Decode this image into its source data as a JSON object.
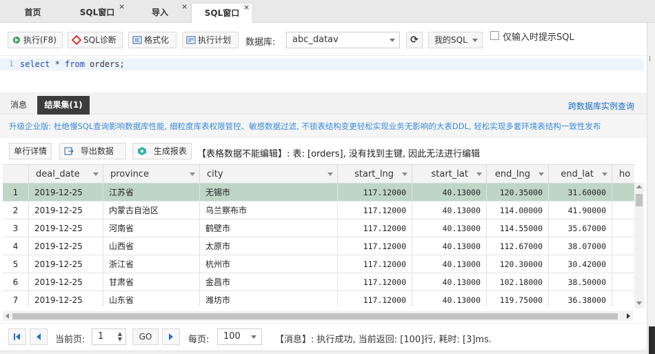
{
  "tabs": [
    {
      "label": "首页",
      "close": ""
    },
    {
      "label": "SQL窗口",
      "close": "×"
    },
    {
      "label": "导入",
      "close": "×"
    },
    {
      "label": "SQL窗口",
      "close": "×"
    }
  ],
  "toolbar": {
    "execute": "执行(F8)",
    "diagnose": "SQL诊断",
    "format": "格式化",
    "plan": "执行计划",
    "db_label": "数据库:",
    "db_value": "abc_datav",
    "my_sql": "我的SQL",
    "hint_only": "仅输入时提示SQL"
  },
  "editor": {
    "line_no": "1",
    "kw_select": "select",
    "star": " * ",
    "kw_from": "from",
    "rest": " orders;"
  },
  "result_tabs": {
    "messages": "消息",
    "result_set": "结果集(1)",
    "cross_db": "跨数据库实例查询"
  },
  "promo": "升级企业版: 杜绝慢SQL查询影响数据库性能, 细粒度库表权限管控、敏感数据过滤, 不锁表结构变更轻松实现业务无影响的大表DDL, 轻松实现多套环境表结构一致性发布",
  "actions": {
    "row_detail": "单行详情",
    "export": "导出数据",
    "report": "生成报表",
    "notice": "【表格数据不能编辑】: 表: [orders], 没有找到主键, 因此无法进行编辑"
  },
  "grid": {
    "columns": [
      "deal_date",
      "province",
      "city",
      "start_lng",
      "start_lat",
      "end_lng",
      "end_lat",
      "ho"
    ],
    "rows": [
      {
        "idx": "1",
        "deal_date": "2019-12-25",
        "province": "江苏省",
        "city": "无锡市",
        "start_lng": "117.12000",
        "start_lat": "40.13000",
        "end_lng": "120.35000",
        "end_lat": "31.60000"
      },
      {
        "idx": "2",
        "deal_date": "2019-12-25",
        "province": "内蒙古自治区",
        "city": "乌兰察布市",
        "start_lng": "117.12000",
        "start_lat": "40.13000",
        "end_lng": "114.00000",
        "end_lat": "41.90000"
      },
      {
        "idx": "3",
        "deal_date": "2019-12-25",
        "province": "河南省",
        "city": "鹤壁市",
        "start_lng": "117.12000",
        "start_lat": "40.13000",
        "end_lng": "114.55000",
        "end_lat": "35.67000"
      },
      {
        "idx": "4",
        "deal_date": "2019-12-25",
        "province": "山西省",
        "city": "太原市",
        "start_lng": "117.12000",
        "start_lat": "40.13000",
        "end_lng": "112.67000",
        "end_lat": "38.07000"
      },
      {
        "idx": "5",
        "deal_date": "2019-12-25",
        "province": "浙江省",
        "city": "杭州市",
        "start_lng": "117.12000",
        "start_lat": "40.13000",
        "end_lng": "120.30000",
        "end_lat": "30.42000"
      },
      {
        "idx": "6",
        "deal_date": "2019-12-25",
        "province": "甘肃省",
        "city": "金昌市",
        "start_lng": "117.12000",
        "start_lat": "40.13000",
        "end_lng": "102.18000",
        "end_lat": "38.50000"
      },
      {
        "idx": "7",
        "deal_date": "2019-12-25",
        "province": "山东省",
        "city": "潍坊市",
        "start_lng": "117.12000",
        "start_lat": "40.13000",
        "end_lng": "119.75000",
        "end_lat": "36.38000"
      }
    ]
  },
  "pager": {
    "current_label": "当前页:",
    "current_page": "1",
    "go": "GO",
    "per_page_label": "每页:",
    "per_page": "100",
    "message": "【消息】: 执行成功, 当前返回: [100]行, 耗时: [3]ms."
  },
  "colors": {
    "selected_row": "#bfd6c6",
    "active_result_tab": "#3c3c3c",
    "link": "#1a6fc4",
    "promo_text": "#3a8ad8",
    "keyword": "#1f3fbf"
  }
}
